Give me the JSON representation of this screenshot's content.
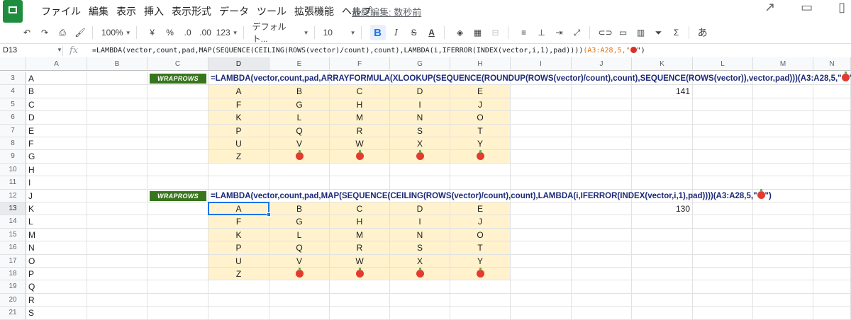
{
  "app": {
    "menu": [
      "ファイル",
      "編集",
      "表示",
      "挿入",
      "表示形式",
      "データ",
      "ツール",
      "拡張機能",
      "ヘルプ"
    ],
    "last_edit": "最終編集: 数秒前"
  },
  "toolbar": {
    "zoom": "100%",
    "currency": "¥",
    "percent": "%",
    "dec_decrease": ".0",
    "dec_increase": ".00",
    "format_more": "123",
    "font": "デフォルト...",
    "font_size": "10",
    "bold": "B",
    "italic": "I",
    "strike": "S",
    "text_color": "A",
    "input_tools": "あ"
  },
  "formula_bar": {
    "name_box": "D13",
    "fx": "fx",
    "formula_main": "=LAMBDA(vector,count,pad,MAP(SEQUENCE(CEILING(ROWS(vector)/count),count),LAMBDA(i,IFERROR(INDEX(vector,i,1),pad))))",
    "formula_range": "(A3:A28,5,\"",
    "formula_end": "\")"
  },
  "sheet": {
    "columns": [
      "A",
      "B",
      "C",
      "D",
      "E",
      "F",
      "G",
      "H",
      "I",
      "J",
      "K",
      "L",
      "M",
      "N"
    ],
    "rows": [
      "3",
      "4",
      "5",
      "6",
      "7",
      "8",
      "9",
      "10",
      "11",
      "12",
      "13",
      "14",
      "15",
      "16",
      "17",
      "18",
      "19",
      "20",
      "21"
    ],
    "colA": [
      "A",
      "B",
      "C",
      "D",
      "E",
      "F",
      "G",
      "H",
      "I",
      "J",
      "K",
      "L",
      "M",
      "N",
      "O",
      "P",
      "Q",
      "R",
      "S"
    ],
    "label1": "WRAPROWS",
    "label2": "WRAPROWS",
    "formula1_main": "=LAMBDA(vector,count,pad,ARRAYFORMULA(XLOOKUP(SEQUENCE(ROUNDUP(ROWS(vector)/count),count),SEQUENCE(ROWS(vector)),vector,pad)))(A3:A28,5,\"",
    "formula1_end": "\")",
    "formula2_main": "=LAMBDA(vector,count,pad,MAP(SEQUENCE(CEILING(ROWS(vector)/count),count),LAMBDA(i,IFERROR(INDEX(vector,i,1),pad))))(A3:A28,5,\"",
    "formula2_end": "\")",
    "k4": "141",
    "k13": "130",
    "block1": [
      [
        "A",
        "B",
        "C",
        "D",
        "E"
      ],
      [
        "F",
        "G",
        "H",
        "I",
        "J"
      ],
      [
        "K",
        "L",
        "M",
        "N",
        "O"
      ],
      [
        "P",
        "Q",
        "R",
        "S",
        "T"
      ],
      [
        "U",
        "V",
        "W",
        "X",
        "Y"
      ],
      [
        "Z",
        "🍎",
        "🍎",
        "🍎",
        "🍎"
      ]
    ],
    "block2": [
      [
        "A",
        "B",
        "C",
        "D",
        "E"
      ],
      [
        "F",
        "G",
        "H",
        "I",
        "J"
      ],
      [
        "K",
        "L",
        "M",
        "N",
        "O"
      ],
      [
        "P",
        "Q",
        "R",
        "S",
        "T"
      ],
      [
        "U",
        "V",
        "W",
        "X",
        "Y"
      ],
      [
        "Z",
        "🍎",
        "🍎",
        "🍎",
        "🍎"
      ]
    ]
  },
  "colors": {
    "label_bg": "#38761d",
    "cell_highlight": "#fff2cc",
    "formula_text": "#1c2a78",
    "select": "#1a73e8"
  }
}
